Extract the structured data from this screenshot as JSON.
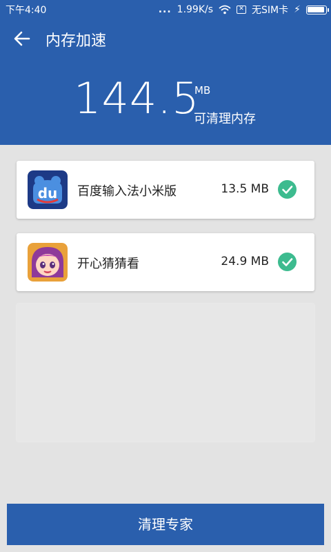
{
  "status_bar": {
    "time": "下午4:40",
    "dots": "...",
    "speed": "1.99K/s",
    "sim_text": "无SIM卡",
    "bolt": "⚡"
  },
  "app_bar": {
    "title": "内存加速"
  },
  "hero": {
    "value": "144.5",
    "unit": "MB",
    "description": "可清理内存"
  },
  "apps": [
    {
      "name": "百度输入法小米版",
      "size": "13.5 MB",
      "icon": "baidu-input-icon",
      "checked": true
    },
    {
      "name": "开心猜猜看",
      "size": "24.9 MB",
      "icon": "game-character-icon",
      "checked": true
    }
  ],
  "bottom_button": {
    "label": "清理专家"
  },
  "colors": {
    "primary": "#2a5fad",
    "check": "#3dbb8f",
    "background": "#e3e3e3"
  }
}
